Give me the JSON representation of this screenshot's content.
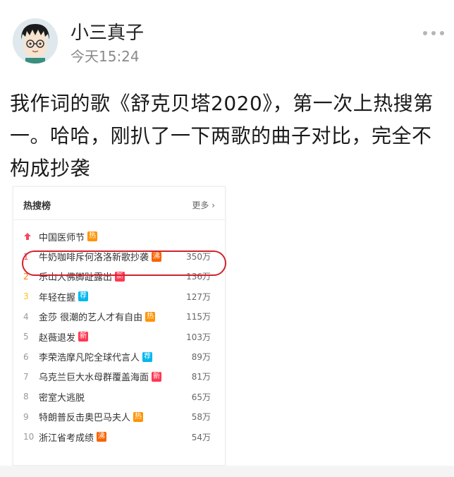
{
  "post": {
    "username": "小三真子",
    "timestamp": "今天15:24",
    "text": "我作词的歌《舒克贝塔2020》，第一次上热搜第一。哈哈，刚扒了一下两歌的曲子对比，完全不构成抄袭"
  },
  "hot_search": {
    "title": "热搜榜",
    "more_label": "更多 ›",
    "items": [
      {
        "rank": "",
        "topic": "中国医师节",
        "badge": "热",
        "badge_type": "hot",
        "count": ""
      },
      {
        "rank": "1",
        "topic": "牛奶咖啡斥何洛洛新歌抄袭",
        "badge": "沸",
        "badge_type": "boil",
        "count": "350万"
      },
      {
        "rank": "2",
        "topic": "乐山大佛脚趾露出",
        "badge": "新",
        "badge_type": "new",
        "count": "136万"
      },
      {
        "rank": "3",
        "topic": "年轻在握",
        "badge": "荐",
        "badge_type": "rec",
        "count": "127万"
      },
      {
        "rank": "4",
        "topic": "金莎 很潮的艺人才有自由",
        "badge": "热",
        "badge_type": "hot",
        "count": "115万"
      },
      {
        "rank": "5",
        "topic": "赵薇退发",
        "badge": "新",
        "badge_type": "new",
        "count": "103万"
      },
      {
        "rank": "6",
        "topic": "李荣浩摩凡陀全球代言人",
        "badge": "荐",
        "badge_type": "rec",
        "count": "89万"
      },
      {
        "rank": "7",
        "topic": "乌克兰巨大水母群覆盖海面",
        "badge": "新",
        "badge_type": "new",
        "count": "81万"
      },
      {
        "rank": "8",
        "topic": "密室大逃脱",
        "badge": "",
        "badge_type": "",
        "count": "65万"
      },
      {
        "rank": "9",
        "topic": "特朗普反击奥巴马夫人",
        "badge": "热",
        "badge_type": "hot",
        "count": "58万"
      },
      {
        "rank": "10",
        "topic": "浙江省考成绩",
        "badge": "沸",
        "badge_type": "boil",
        "count": "54万"
      }
    ]
  },
  "colors": {
    "highlight": "#d2222d",
    "badge_hot": "#ff9406",
    "badge_new": "#ff3852",
    "badge_rec": "#00b7ee",
    "badge_boil": "#f86400"
  },
  "icons": {
    "more": "more-dots-icon",
    "pinned": "pin-arrow-icon",
    "avatar": "anime-avatar"
  }
}
